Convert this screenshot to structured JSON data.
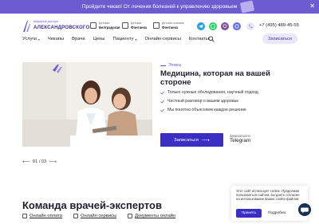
{
  "promo": {
    "text": "Пройдите чекап! От лечения болезней к управлению здоровьем"
  },
  "logo": {
    "small": "медицина доктора",
    "big": "АЛЕКСАНДРОВСКОГО"
  },
  "clinics": [
    {
      "line1": "Детская",
      "line2": "Белградская"
    },
    {
      "line1": "Детская",
      "line2": "Фонтанка"
    },
    {
      "line1": "Детская клиника",
      "line2": "Фонтанка"
    }
  ],
  "header": {
    "phone": "+7 (495) 489-45-55",
    "signup_label": "Записаться"
  },
  "nav": [
    {
      "label": "Услуги",
      "dropdown": true
    },
    {
      "label": "Чекапы",
      "dropdown": false
    },
    {
      "label": "Врачи",
      "dropdown": false
    },
    {
      "label": "Цены",
      "dropdown": false
    },
    {
      "label": "Пациенту",
      "dropdown": true
    },
    {
      "label": "Онлайн-сервисы",
      "dropdown": false
    },
    {
      "label": "Контакты",
      "dropdown": false
    }
  ],
  "hero": {
    "tag": "Этика",
    "title": "Медицина, которая на вашей стороне",
    "bullets": [
      "Только нужные обследования, научный подход",
      "Честный разговор о вашем здоровье",
      "Мы понятно объясняем каждое решение"
    ],
    "cta_label": "Записаться",
    "telegram_small": "Записаться в",
    "telegram_big": "Telegram"
  },
  "pager": {
    "text": "01 / 03"
  },
  "team": {
    "title": "Команда врачей-экспертов",
    "links": [
      "Онлайн оплата",
      "Онлайн сервисы",
      "Документы онлайн"
    ]
  },
  "cookie": {
    "text": "Этот сайт использует cookie. Продолжая пользоваться сайтом, вы даете согласие на использование ваших cookie-файлов",
    "accept": "Принять",
    "more": "Подробно"
  },
  "colors": {
    "accent": "#6d5bd0",
    "primary": "#3a2ec3",
    "telegram": "#2aa1db",
    "whatsapp": "#25d366",
    "viber": "#7b519d",
    "max": "#5b6ee8"
  }
}
